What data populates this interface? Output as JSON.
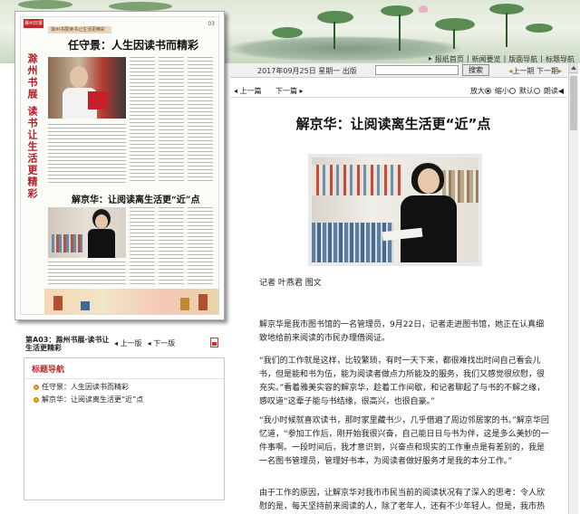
{
  "top_links": [
    "报纸首页",
    "新闻要览",
    "版面导航",
    "标题导航"
  ],
  "newspaper": {
    "vertical_title": "滁州书展 读书让生活更精彩",
    "page_no": "03",
    "band_text": "滁州书展读书让生活更精彩",
    "headline1": "任守景：人生因读书而精彩",
    "headline2": "解京华：让阅读离生活更“近”点",
    "logo": "滁州日报"
  },
  "page_caption": "第A03：滁州书展·读书让生活更精彩",
  "page_nav": {
    "prev": "上一版",
    "next": "下一版"
  },
  "headline_nav": {
    "title": "标题导航",
    "items": [
      "任守景：人生因读书而精彩",
      "解京华：让阅读离生活更“近”点"
    ]
  },
  "date_bar": {
    "date": "2017年09月25日 星期一 出版",
    "search_placeholder": "",
    "search_button": "搜索",
    "prev_page": "上一期",
    "next_page": "下一期"
  },
  "toolbar": {
    "prev": "上一篇",
    "next": "下一篇",
    "zoom_in": "放大",
    "zoom_out": "缩小",
    "default": "默认",
    "read_aloud": "朗读"
  },
  "article": {
    "title": "解京华：让阅读离生活更“近”点",
    "byline": "记者 叶燕君 图文",
    "paragraphs": [
      "解京华是我市图书馆的一名管理员，9月22日，记者走进图书馆，她正在认真细致地给前来阅读的市民办理借阅证。",
      "“我们的工作就是这样，比较繁琐，有时一天下来，都很难找出时间自己看会儿书，但是能和书为伍，能为阅读者做点力所能及的服务，我们又感觉很欣慰，很充实。”看着雅美实容的解京华，趁着工作间歇，和记者聊起了与书的不解之缘，感叹道“这辈子能与书结缘，很高兴，也很自豪。”",
      "“我小时候就喜欢读书，那时家里藏书少，几乎借遍了周边邻居家的书。”解京华回忆道，“参加工作后，刚开始我很兴奋，自己能日日与书为伴，这是多么美妙的一件事啊。一段时间后，我才意识到，兴奋点和现实的工作重点是有差别的，我是一名图书管理员，管理好书本，为阅读者做好服务才是我的本分工作。”",
      "由于工作的原因，让解京华对我市市民当前的阅读状况有了深入的思考：令人欣慰的是，每天坚持前来阅读的人，除了老年人，还有不少年轻人。但是，我市热爱阅"
    ]
  },
  "colors": {
    "accent_red": "#c0282a",
    "nav_dot": "#e3b020"
  }
}
